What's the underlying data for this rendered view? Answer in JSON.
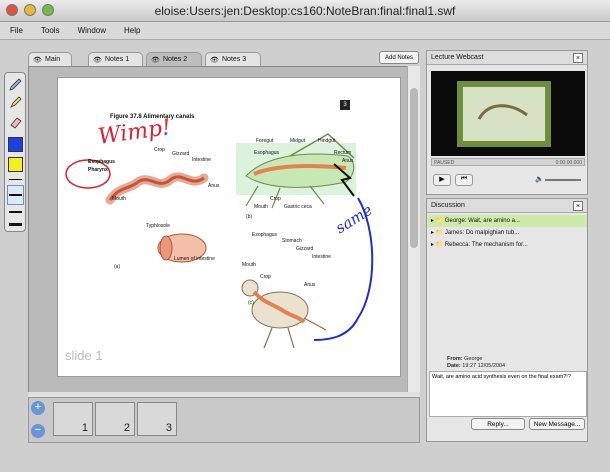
{
  "window": {
    "title": "eloise:Users:jen:Desktop:cs160:NoteBran:final:final1.swf"
  },
  "menu": [
    "File",
    "Tools",
    "Window",
    "Help"
  ],
  "tabs": [
    {
      "label": "Main",
      "active": false
    },
    {
      "label": "Notes 1",
      "active": false
    },
    {
      "label": "Notes 2",
      "active": true
    },
    {
      "label": "Notes 3",
      "active": false
    }
  ],
  "add_notes_label": "Add Notes",
  "slide": {
    "figure_title": "Figure 37.8  Alimentary canals",
    "figure_number": "3",
    "labels_a": [
      "Crop",
      "Gizzard",
      "Intestine",
      "Esophagus",
      "Pharynx",
      "Mouth",
      "Anus",
      "Typhlosole",
      "Lumen of intestine",
      "(a)"
    ],
    "labels_b": [
      "Foregut",
      "Midgut",
      "Hindgut",
      "Esophagus",
      "Rectum",
      "Anus",
      "Crop",
      "Mouth",
      "Gastric ceca",
      "(b)"
    ],
    "labels_c": [
      "Esophagus",
      "Stomach",
      "Gizzard",
      "Intestine",
      "Mouth",
      "Crop",
      "Anus",
      "(c)"
    ],
    "annotation_1": "Wimp!",
    "annotation_2": "same",
    "slide_label": "slide 1"
  },
  "thumbnails": [
    "1",
    "2",
    "3"
  ],
  "zoom": {
    "in": "+",
    "out": "−"
  },
  "webcast": {
    "title": "Lecture Webcast",
    "status": "PAUSED",
    "time": "0:00:00.000"
  },
  "discussion": {
    "title": "Discussion",
    "threads": [
      {
        "text": "George: Wait, are amino a...",
        "selected": true
      },
      {
        "text": "James: Do malpighian tub...",
        "selected": false
      },
      {
        "text": "Rebecca: The mechanism for...",
        "selected": false
      }
    ],
    "from_label": "From:",
    "from_value": "George",
    "date_label": "Date:",
    "date_value": "19:27 12/05/2004",
    "message": "Wait, are amino acid synthesis even on the final exam?!?",
    "reply_label": "Reply...",
    "new_label": "New Message..."
  },
  "colors": {
    "annotation_red": "#e0202f",
    "annotation_blue": "#1a2fd0",
    "selected_row": "#cdeaa8",
    "accent_blue": "#6a96d6"
  }
}
